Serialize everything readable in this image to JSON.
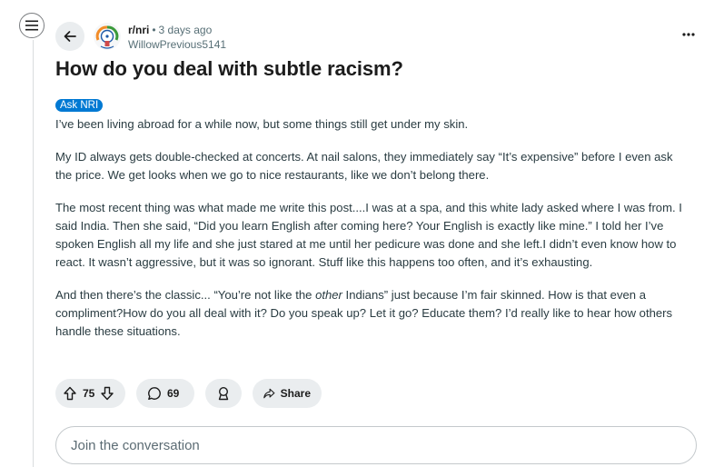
{
  "post": {
    "subreddit": "r/nri",
    "separator": "•",
    "time": "3 days ago",
    "author": "WillowPrevious5141",
    "title": "How do you deal with subtle racism?",
    "flair": "Ask NRI",
    "paragraphs": {
      "p1": "I’ve been living abroad for a while now, but some things still get under my skin.",
      "p2": "My ID always gets double-checked at concerts. At nail salons, they immediately say “It’s expensive” before I even ask the price. We get looks when we go to nice restaurants, like we don’t belong there.",
      "p3": "The most recent thing was what made me write this post....I was at a spa, and this white lady asked where I was from. I said India. Then she said, “Did you learn English after coming here? Your English is exactly like mine.” I told her I’ve spoken English all my life and she just stared at me until her pedicure was done and she left.I didn’t even know how to react. It wasn’t aggressive, but it was so ignorant. Stuff like this happens too often, and it’s exhausting.",
      "p4_before": "And then there’s the classic... “You’re not like the ",
      "p4_em": "other",
      "p4_after": " Indians” just because I’m fair skinned. How is that even a compliment?How do you all deal with it? Do you speak up? Let it go? Educate them? I’d really like to hear how others handle these situations."
    }
  },
  "actions": {
    "votes": "75",
    "comments": "69",
    "share_label": "Share"
  },
  "comment_box": {
    "placeholder": "Join the conversation"
  },
  "icons": {
    "menu": "menu-icon",
    "back": "back-arrow-icon",
    "more": "more-dots-icon",
    "upvote": "upvote-icon",
    "downvote": "downvote-icon",
    "comment": "comment-bubble-icon",
    "award": "award-icon",
    "share": "share-arrow-icon"
  },
  "colors": {
    "flair_bg": "#0079d3",
    "pill_bg": "#eaedef",
    "meta_text": "#576f76"
  }
}
